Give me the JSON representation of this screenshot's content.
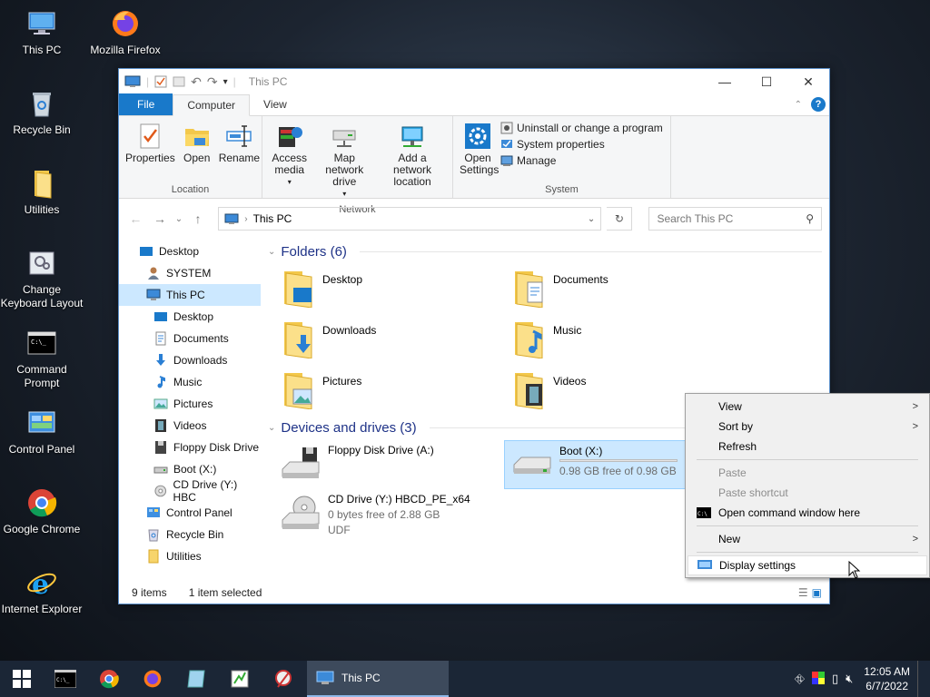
{
  "desktop": {
    "icons": [
      {
        "label": "This PC",
        "icon": "computer-icon"
      },
      {
        "label": "Mozilla Firefox",
        "icon": "firefox-icon"
      },
      {
        "label": "Recycle Bin",
        "icon": "recycle-bin-icon"
      },
      {
        "label": "Utilities",
        "icon": "folder-icon"
      },
      {
        "label": "Change Keyboard Layout",
        "icon": "keyboard-layout-icon"
      },
      {
        "label": "Command Prompt",
        "icon": "command-prompt-icon"
      },
      {
        "label": "Control Panel",
        "icon": "control-panel-icon"
      },
      {
        "label": "Google Chrome",
        "icon": "chrome-icon"
      },
      {
        "label": "Internet Explorer",
        "icon": "internet-explorer-icon"
      }
    ]
  },
  "window": {
    "title": "This PC",
    "tabs": [
      "File",
      "Computer",
      "View"
    ],
    "ribbon": {
      "location": {
        "name": "Location",
        "buttons": [
          "Properties",
          "Open",
          "Rename"
        ]
      },
      "network": {
        "name": "Network",
        "buttons": [
          "Access media",
          "Map network drive",
          "Add a network location"
        ]
      },
      "system": {
        "name": "System",
        "open_settings": "Open Settings",
        "items": [
          "Uninstall or change a program",
          "System properties",
          "Manage"
        ]
      }
    },
    "address": {
      "path": "This PC",
      "search_placeholder": "Search This PC"
    },
    "nav": [
      {
        "label": "Desktop",
        "level": 0
      },
      {
        "label": "SYSTEM",
        "level": 1
      },
      {
        "label": "This PC",
        "level": 1,
        "selected": true
      },
      {
        "label": "Desktop",
        "level": 2
      },
      {
        "label": "Documents",
        "level": 2
      },
      {
        "label": "Downloads",
        "level": 2
      },
      {
        "label": "Music",
        "level": 2
      },
      {
        "label": "Pictures",
        "level": 2
      },
      {
        "label": "Videos",
        "level": 2
      },
      {
        "label": "Floppy Disk Drive",
        "level": 2
      },
      {
        "label": "Boot (X:)",
        "level": 2
      },
      {
        "label": "CD Drive (Y:) HBC",
        "level": 2
      },
      {
        "label": "Control Panel",
        "level": 1
      },
      {
        "label": "Recycle Bin",
        "level": 1
      },
      {
        "label": "Utilities",
        "level": 1
      }
    ],
    "folders_header": "Folders (6)",
    "folders": [
      "Desktop",
      "Documents",
      "Downloads",
      "Music",
      "Pictures",
      "Videos"
    ],
    "drives_header": "Devices and drives (3)",
    "drives": [
      {
        "name": "Floppy Disk Drive (A:)",
        "free": "",
        "fs": ""
      },
      {
        "name": "Boot (X:)",
        "free": "0.98 GB free of 0.98 GB",
        "fs": "",
        "selected": true,
        "used_fraction": 0.0
      },
      {
        "name": "CD Drive (Y:) HBCD_PE_x64",
        "free": "0 bytes free of 2.88 GB",
        "fs": "UDF"
      }
    ],
    "status": {
      "items": "9 items",
      "selected": "1 item selected"
    }
  },
  "context_menu": {
    "items": [
      "View",
      "Sort by",
      "Refresh",
      "Paste",
      "Paste shortcut",
      "Open command window here",
      "New",
      "Display settings"
    ]
  },
  "taskbar": {
    "active_label": "This PC",
    "time": "12:05 AM",
    "date": "6/7/2022"
  }
}
